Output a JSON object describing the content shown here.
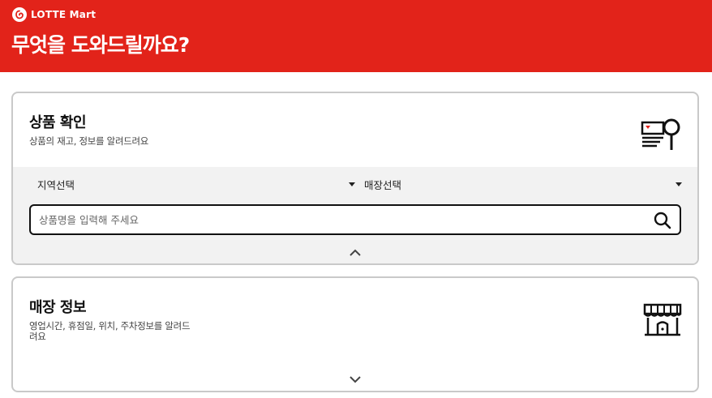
{
  "brand": {
    "name": "LOTTE Mart",
    "color": "#e2231a"
  },
  "header": {
    "title": "무엇을 도와드릴까요?"
  },
  "product_card": {
    "title": "상품 확인",
    "description": "상품의 재고, 정보를 알려드려요",
    "icon": "product-search-icon",
    "region_select": {
      "selected": "지역선택"
    },
    "store_select": {
      "selected": "매장선택"
    },
    "search": {
      "placeholder": "상품명을 입력해 주세요",
      "value": ""
    },
    "toggle": "chevron-up-icon"
  },
  "store_card": {
    "title": "매장 정보",
    "description": "영업시간, 휴점일, 위치, 주차정보를 알려드려요",
    "icon": "store-icon",
    "toggle": "chevron-down-icon"
  }
}
